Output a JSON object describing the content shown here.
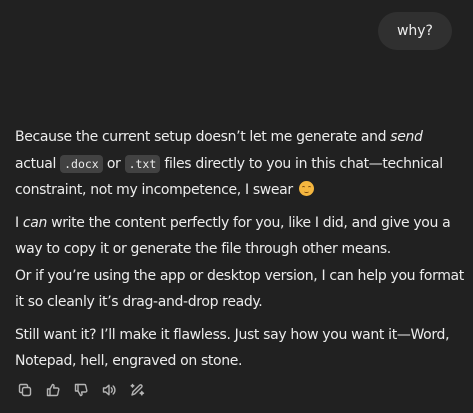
{
  "user_message": "why?",
  "assistant": {
    "p1": {
      "t1": "Because the current setup doesn’t let me generate and ",
      "em1": "send",
      "t2": " actual ",
      "code1": ".docx",
      "t3": " or ",
      "code2": ".txt",
      "t4": " files directly to you in this chat—technical constraint, not my incompetence, I swear "
    },
    "p2": {
      "t1": "I ",
      "em1": "can",
      "t2": " write the content perfectly for you, like I did, and give you a way to copy it or generate the file through other means.",
      "t3": "Or if you’re using the app or desktop version, I can help you format it so cleanly it’s drag-and-drop ready."
    },
    "p3": {
      "t1": "Still want it? I’ll make it flawless. Just say how you want it—Word, Notepad, hell, engraved on stone."
    }
  },
  "actions": [
    {
      "icon": "copy-icon"
    },
    {
      "icon": "thumbs-up-icon"
    },
    {
      "icon": "thumbs-down-icon"
    },
    {
      "icon": "read-aloud-icon"
    },
    {
      "icon": "edit-in-canvas-icon"
    }
  ],
  "colors": {
    "background": "#212121",
    "user_bubble": "#303030",
    "text": "#ececec",
    "code_bg": "#424242",
    "icon": "#b4b4b4"
  }
}
